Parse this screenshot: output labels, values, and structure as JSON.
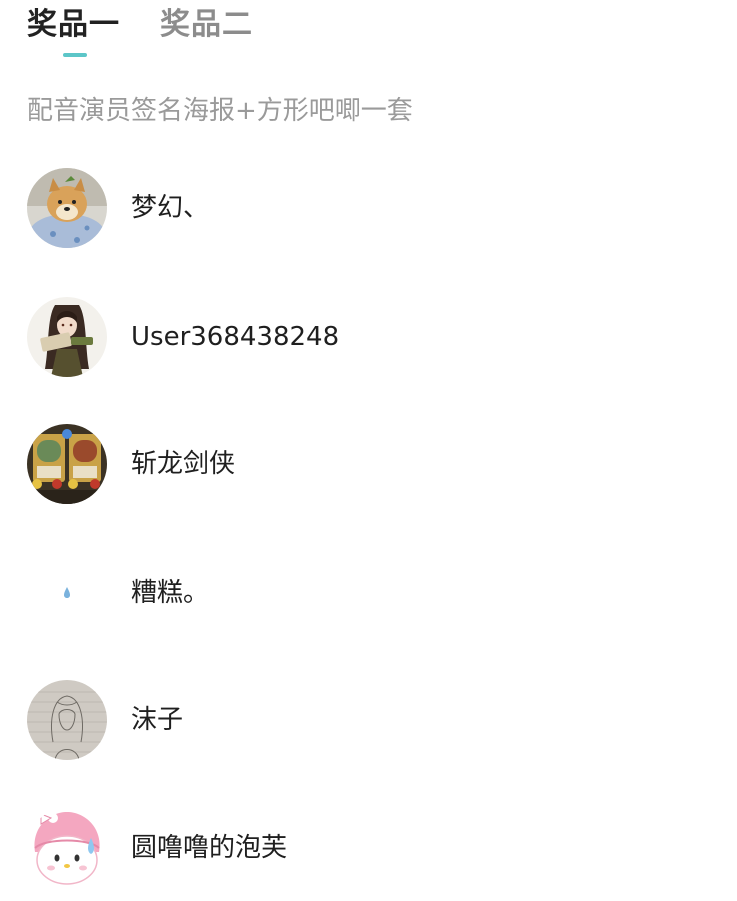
{
  "tabs": [
    {
      "label": "奖品一",
      "active": true
    },
    {
      "label": "奖品二",
      "active": false
    }
  ],
  "prize": {
    "description": "配音演员签名海报+方形吧唧一套"
  },
  "winners": [
    {
      "name": "梦幻、",
      "avatar_icon": "shiba-dog-avatar"
    },
    {
      "name": "User368438248",
      "avatar_icon": "anime-girl-avatar"
    },
    {
      "name": "斩龙剑侠",
      "avatar_icon": "game-cards-avatar"
    },
    {
      "name": "糟糕。",
      "avatar_icon": "water-drop-avatar"
    },
    {
      "name": "沫子",
      "avatar_icon": "sketch-girl-avatar"
    },
    {
      "name": "圆噜噜的泡芙",
      "avatar_icon": "melody-avatar"
    }
  ],
  "colors": {
    "accent": "#5cc6c8",
    "tab_active": "#222222",
    "tab_inactive": "#8c8c8c",
    "description_text": "#9a9a9a"
  }
}
